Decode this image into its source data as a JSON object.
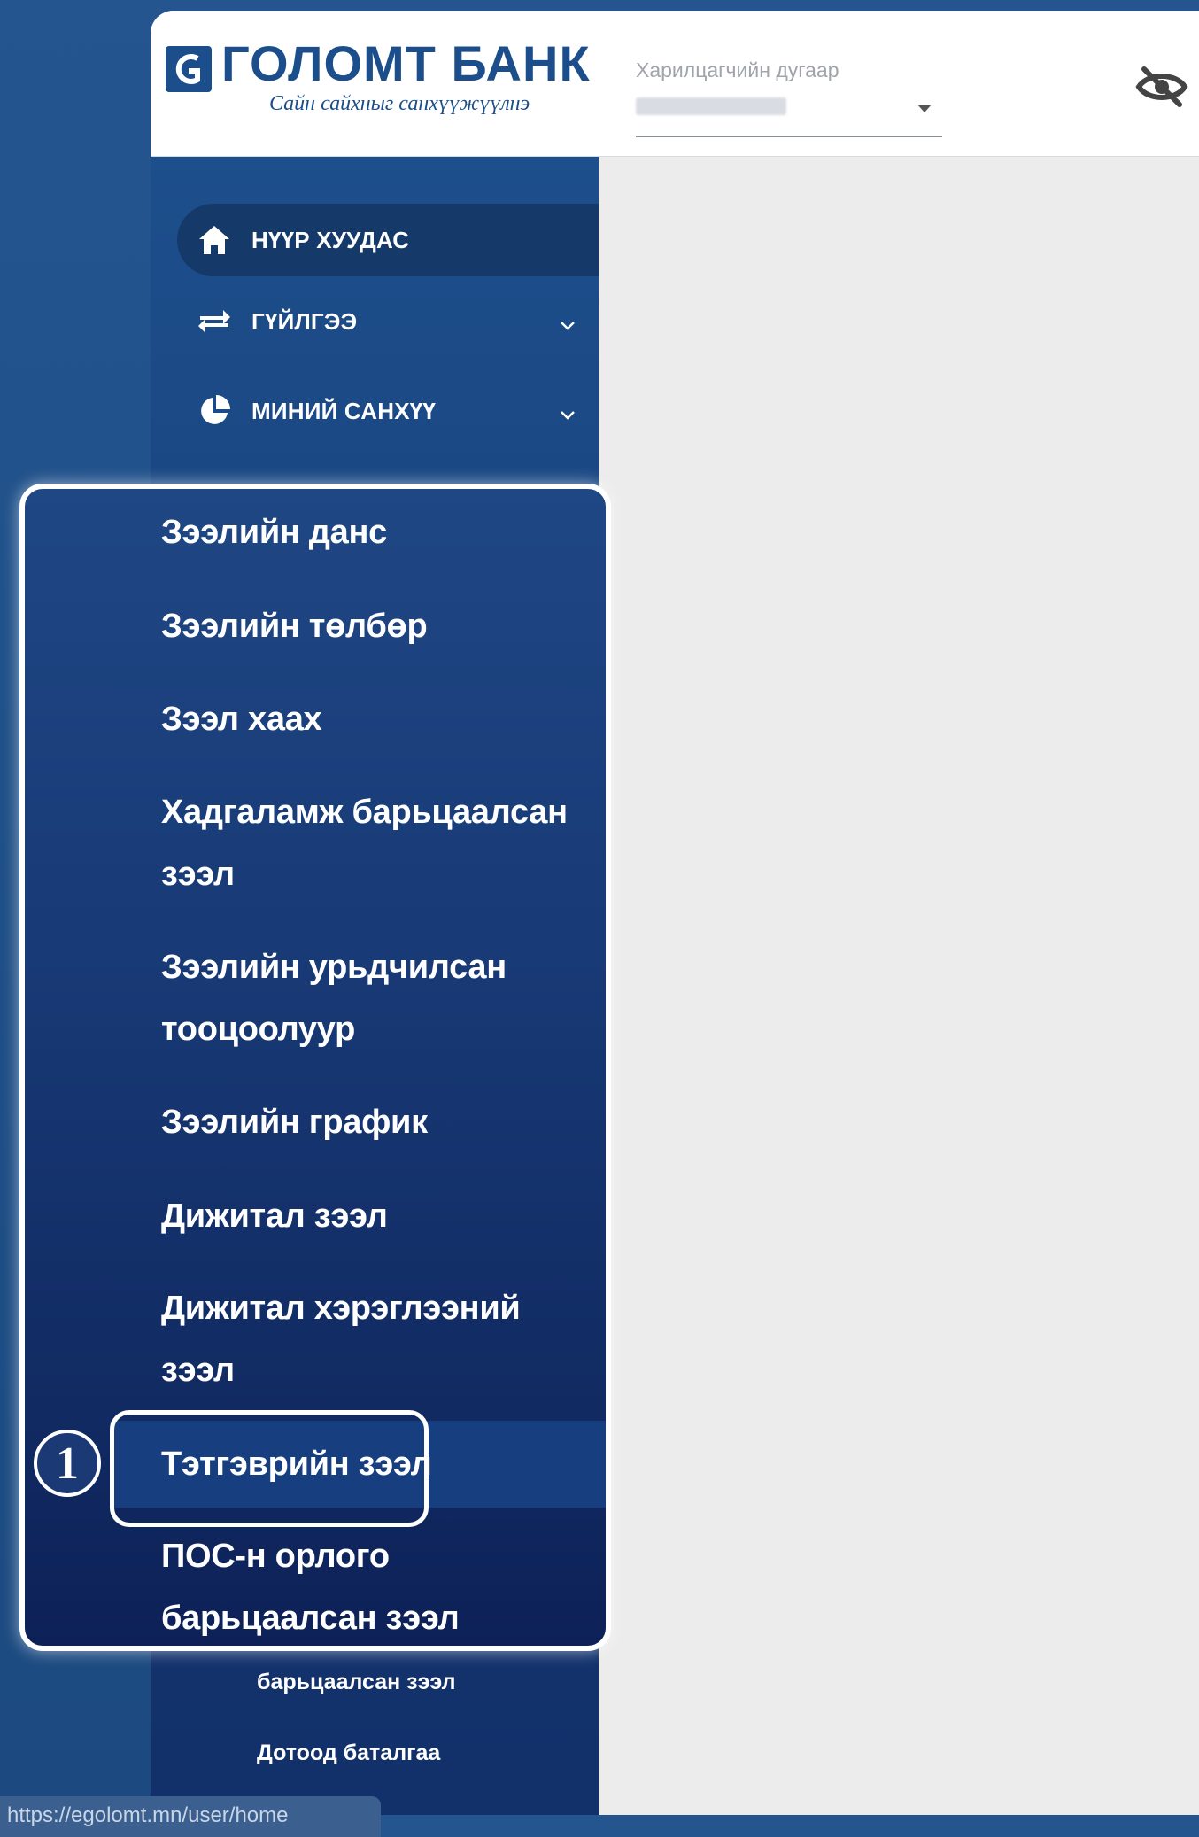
{
  "header": {
    "logo_title": "ГОЛОМТ БАНК",
    "logo_slogan": "Сайн сайхныг санхүүжүүлнэ",
    "customer_field": {
      "label": "Харилцагчийн дугаар"
    }
  },
  "sidebar": {
    "items": [
      {
        "label": "НҮҮР ХУУДАС",
        "icon": "home-icon"
      },
      {
        "label": "ГҮЙЛГЭЭ",
        "icon": "transfer-arrows-icon"
      },
      {
        "label": "МИНИЙ САНХҮҮ",
        "icon": "pie-chart-icon"
      }
    ],
    "under_items": [
      {
        "label": "барьцаалсан зээл"
      },
      {
        "label": "Дотоод баталгаа"
      }
    ],
    "url_tooltip": "https://egolomt.mn/user/home"
  },
  "loan_menu": {
    "items": [
      {
        "label": "Зээлийн данс"
      },
      {
        "label": "Зээлийн төлбөр"
      },
      {
        "label": "Зээл хаах"
      },
      {
        "label": "Хадгаламж барьцаалсан зээл"
      },
      {
        "label": "Зээлийн урьдчилсан тооцоолуур"
      },
      {
        "label": "Зээлийн график"
      },
      {
        "label": "Дижитал зээл"
      },
      {
        "label": "Дижитал хэрэглээний зээл"
      },
      {
        "label": "Тэтгэврийн зээл"
      },
      {
        "label": "ПОС-н орлого барьцаалсан зээл"
      }
    ],
    "step_badge": "1"
  }
}
